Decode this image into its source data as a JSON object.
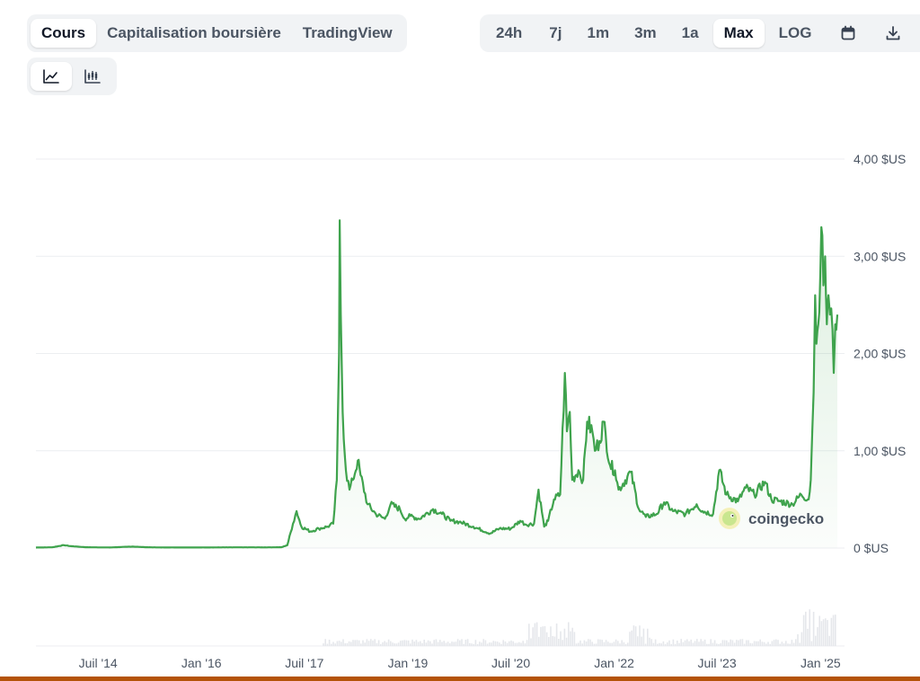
{
  "tabs": [
    {
      "label": "Cours",
      "active": true
    },
    {
      "label": "Capitalisation boursière",
      "active": false
    },
    {
      "label": "TradingView",
      "active": false
    }
  ],
  "ranges": [
    {
      "label": "24h",
      "active": false
    },
    {
      "label": "7j",
      "active": false
    },
    {
      "label": "1m",
      "active": false
    },
    {
      "label": "3m",
      "active": false
    },
    {
      "label": "1a",
      "active": false
    },
    {
      "label": "Max",
      "active": true
    },
    {
      "label": "LOG",
      "active": false
    }
  ],
  "toolbar_icons": [
    "calendar-icon",
    "download-icon"
  ],
  "chart_type_icons": [
    "line-chart-icon",
    "candlestick-chart-icon"
  ],
  "watermark": "coingecko",
  "colors": {
    "line": "#3fa34d",
    "fill": "#dff3e1",
    "grid": "#eceef1",
    "volume": "#e5e7eb",
    "accent_bottom": "#b45309"
  },
  "chart_data": {
    "type": "line",
    "title": "",
    "xlabel": "",
    "ylabel": "",
    "ylim": [
      0,
      4
    ],
    "y_ticks": [
      {
        "value": 4,
        "label": "4,00 $US"
      },
      {
        "value": 3,
        "label": "3,00 $US"
      },
      {
        "value": 2,
        "label": "2,00 $US"
      },
      {
        "value": 1,
        "label": "1,00 $US"
      },
      {
        "value": 0,
        "label": "0 $US"
      }
    ],
    "x_ticks": [
      {
        "date": "2014-07-01",
        "label": "Juil '14"
      },
      {
        "date": "2016-01-01",
        "label": "Jan '16"
      },
      {
        "date": "2017-07-01",
        "label": "Juil '17"
      },
      {
        "date": "2019-01-01",
        "label": "Jan '19"
      },
      {
        "date": "2020-07-01",
        "label": "Juil '20"
      },
      {
        "date": "2022-01-01",
        "label": "Jan '22"
      },
      {
        "date": "2023-07-01",
        "label": "Juil '23"
      },
      {
        "date": "2025-01-01",
        "label": "Jan '25"
      }
    ],
    "xlim": [
      "2013-08-05",
      "2025-03-31"
    ],
    "grid": true,
    "series": [
      {
        "x": [
          "2013-08-05",
          "2013-11-01",
          "2014-01-01",
          "2014-02-01",
          "2014-05-01",
          "2014-09-01",
          "2015-01-01",
          "2015-03-15",
          "2015-06-01",
          "2016-01-01",
          "2016-06-01",
          "2017-01-01",
          "2017-03-01",
          "2017-04-01",
          "2017-05-01",
          "2017-05-20",
          "2017-06-15",
          "2017-08-01",
          "2017-09-15",
          "2017-11-01",
          "2017-12-01",
          "2017-12-20",
          "2018-01-01",
          "2018-01-04",
          "2018-01-10",
          "2018-01-20",
          "2018-02-06",
          "2018-02-25",
          "2018-03-15",
          "2018-04-10",
          "2018-04-25",
          "2018-06-01",
          "2018-07-15",
          "2018-09-01",
          "2018-10-01",
          "2018-11-20",
          "2018-12-15",
          "2019-01-15",
          "2019-03-01",
          "2019-05-15",
          "2019-07-01",
          "2019-08-15",
          "2019-10-01",
          "2019-12-15",
          "2020-03-13",
          "2020-05-01",
          "2020-07-01",
          "2020-08-20",
          "2020-09-20",
          "2020-11-01",
          "2020-11-25",
          "2020-12-25",
          "2021-01-15",
          "2021-02-15",
          "2021-03-20",
          "2021-04-14",
          "2021-04-25",
          "2021-05-10",
          "2021-05-23",
          "2021-06-25",
          "2021-07-20",
          "2021-08-10",
          "2021-09-07",
          "2021-09-20",
          "2021-10-15",
          "2021-11-05",
          "2021-12-10",
          "2022-01-05",
          "2022-01-24",
          "2022-03-30",
          "2022-05-12",
          "2022-06-18",
          "2022-08-15",
          "2022-09-23",
          "2022-11-09",
          "2023-01-15",
          "2023-03-15",
          "2023-04-15",
          "2023-06-10",
          "2023-07-13",
          "2023-08-20",
          "2023-10-20",
          "2023-12-01",
          "2024-01-15",
          "2024-03-11",
          "2024-04-15",
          "2024-06-01",
          "2024-08-05",
          "2024-09-20",
          "2024-10-30",
          "2024-11-10",
          "2024-11-18",
          "2024-11-25",
          "2024-12-03",
          "2024-12-10",
          "2024-12-20",
          "2025-01-05",
          "2025-01-16",
          "2025-01-25",
          "2025-02-03",
          "2025-02-12",
          "2025-02-20",
          "2025-03-05",
          "2025-03-12",
          "2025-03-20",
          "2025-03-31"
        ],
        "y": [
          0.005,
          0.008,
          0.03,
          0.02,
          0.008,
          0.006,
          0.015,
          0.008,
          0.006,
          0.006,
          0.007,
          0.007,
          0.008,
          0.03,
          0.25,
          0.38,
          0.22,
          0.17,
          0.2,
          0.22,
          0.25,
          0.7,
          2.0,
          3.37,
          2.4,
          1.4,
          0.8,
          0.6,
          0.7,
          0.9,
          0.75,
          0.45,
          0.35,
          0.3,
          0.45,
          0.4,
          0.3,
          0.33,
          0.3,
          0.4,
          0.35,
          0.28,
          0.27,
          0.22,
          0.15,
          0.2,
          0.2,
          0.28,
          0.24,
          0.25,
          0.6,
          0.22,
          0.28,
          0.5,
          0.55,
          1.8,
          1.2,
          1.4,
          0.7,
          0.8,
          0.7,
          1.3,
          1.2,
          1.0,
          1.1,
          1.3,
          0.85,
          0.8,
          0.6,
          0.78,
          0.4,
          0.32,
          0.35,
          0.47,
          0.38,
          0.35,
          0.45,
          0.38,
          0.35,
          0.8,
          0.55,
          0.48,
          0.62,
          0.55,
          0.68,
          0.5,
          0.48,
          0.45,
          0.55,
          0.5,
          0.7,
          1.2,
          1.6,
          2.6,
          2.1,
          2.3,
          3.3,
          2.7,
          3.0,
          2.3,
          2.6,
          2.4,
          2.25,
          1.8,
          2.3,
          2.4
        ]
      }
    ]
  }
}
